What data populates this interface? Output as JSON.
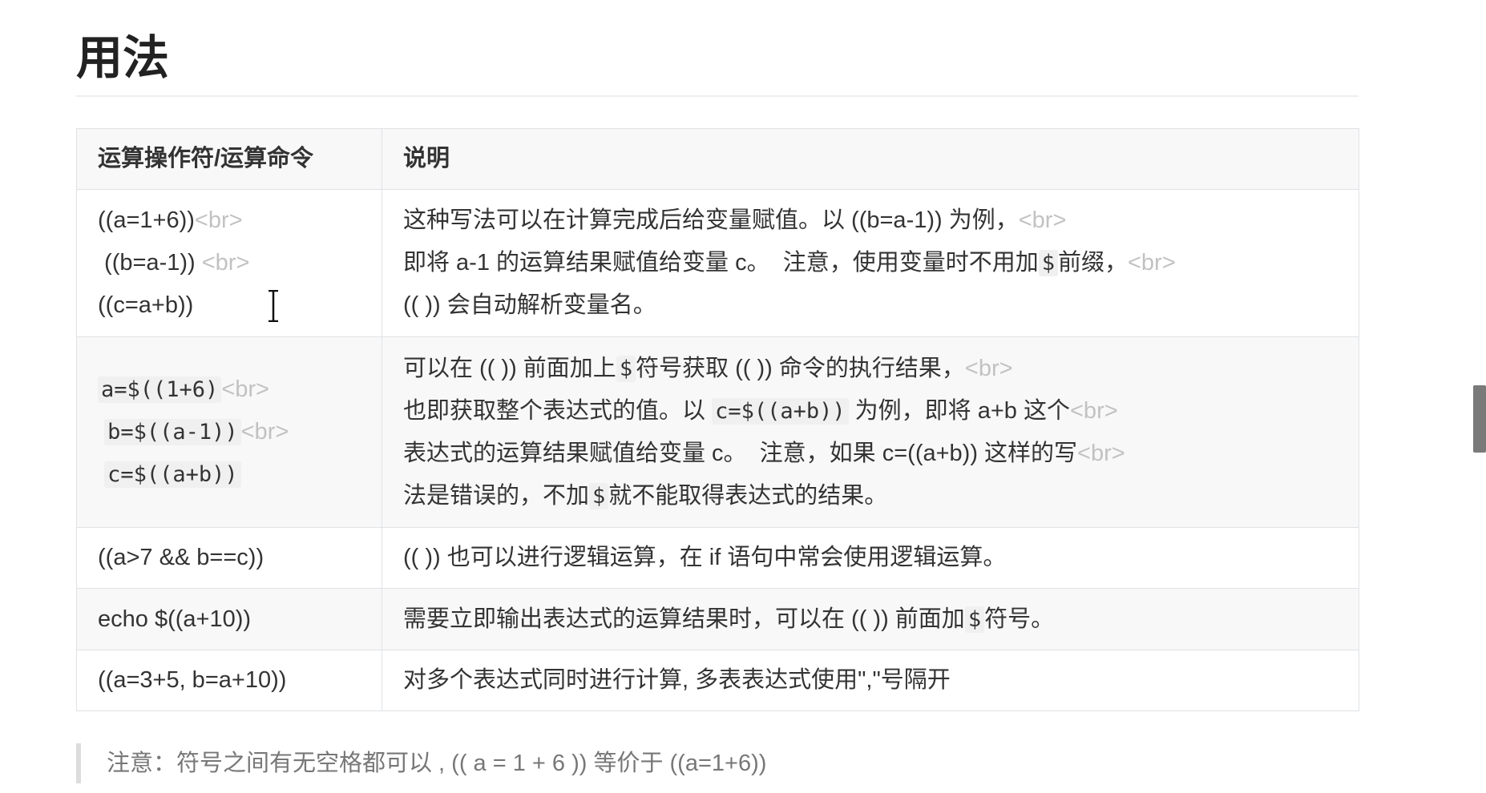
{
  "heading": "用法",
  "table": {
    "headers": [
      "运算操作符/运算命令",
      "说明"
    ],
    "rows": [
      {
        "op_lines": [
          {
            "text": "((a=1+6))",
            "br": "<br>"
          },
          {
            "text": " ((b=a-1)) ",
            "br": "<br>"
          },
          {
            "text": "((c=a+b))",
            "br": ""
          }
        ],
        "desc_lines": [
          {
            "parts": [
              {
                "t": "这种写法可以在计算完成后给变量赋值。以 ((b=a-1)) 为例，"
              },
              {
                "br": "<br>"
              }
            ]
          },
          {
            "parts": [
              {
                "t": "即将 a-1 的运算结果赋值给变量 c。  注意，使用变量时不用加"
              },
              {
                "code": "$"
              },
              {
                "t": "前缀，"
              },
              {
                "br": "<br>"
              }
            ]
          },
          {
            "parts": [
              {
                "t": "(( )) 会自动解析变量名。"
              }
            ]
          }
        ]
      },
      {
        "op_lines": [
          {
            "code": "a=$((1+6)",
            "br": "<br>"
          },
          {
            "code": "b=$((a-1))",
            "br": "<br>"
          },
          {
            "code": "c=$((a+b))",
            "br": ""
          }
        ],
        "desc_lines": [
          {
            "parts": [
              {
                "t": "可以在 (( )) 前面加上"
              },
              {
                "code": "$"
              },
              {
                "t": "符号获取 (( )) 命令的执行结果，"
              },
              {
                "br": "<br>"
              }
            ]
          },
          {
            "parts": [
              {
                "t": "也即获取整个表达式的值。以 "
              },
              {
                "code": "c=$((a+b))"
              },
              {
                "t": " 为例，即将 a+b 这个"
              },
              {
                "br": "<br>"
              }
            ]
          },
          {
            "parts": [
              {
                "t": "表达式的运算结果赋值给变量 c。  注意，如果 c=((a+b)) 这样的写"
              },
              {
                "br": "<br>"
              }
            ]
          },
          {
            "parts": [
              {
                "t": "法是错误的，不加"
              },
              {
                "code": "$"
              },
              {
                "t": "就不能取得表达式的结果。"
              }
            ]
          }
        ]
      },
      {
        "op_lines": [
          {
            "text": "((a>7 && b==c))",
            "br": ""
          }
        ],
        "desc_lines": [
          {
            "parts": [
              {
                "t": "(( )) 也可以进行逻辑运算，在 if 语句中常会使用逻辑运算。"
              }
            ]
          }
        ]
      },
      {
        "op_lines": [
          {
            "text": "echo $((a+10))",
            "br": ""
          }
        ],
        "desc_lines": [
          {
            "parts": [
              {
                "t": "需要立即输出表达式的运算结果时，可以在 (( )) 前面加"
              },
              {
                "code": "$"
              },
              {
                "t": "符号。"
              }
            ]
          }
        ]
      },
      {
        "op_lines": [
          {
            "text": "((a=3+5, b=a+10))",
            "br": ""
          }
        ],
        "desc_lines": [
          {
            "parts": [
              {
                "t": "对多个表达式同时进行计算, 多表表达式使用\",\"号隔开"
              }
            ]
          }
        ]
      }
    ]
  },
  "note": "注意：符号之间有无空格都可以 , (( a = 1 + 6 )) 等价于 ((a=1+6))",
  "colors": {
    "header_bg": "#f8f8f8",
    "border": "#dfe2e5",
    "br_tag": "#c2c2c2",
    "note_text": "#777777",
    "note_bar": "#dddddd"
  }
}
